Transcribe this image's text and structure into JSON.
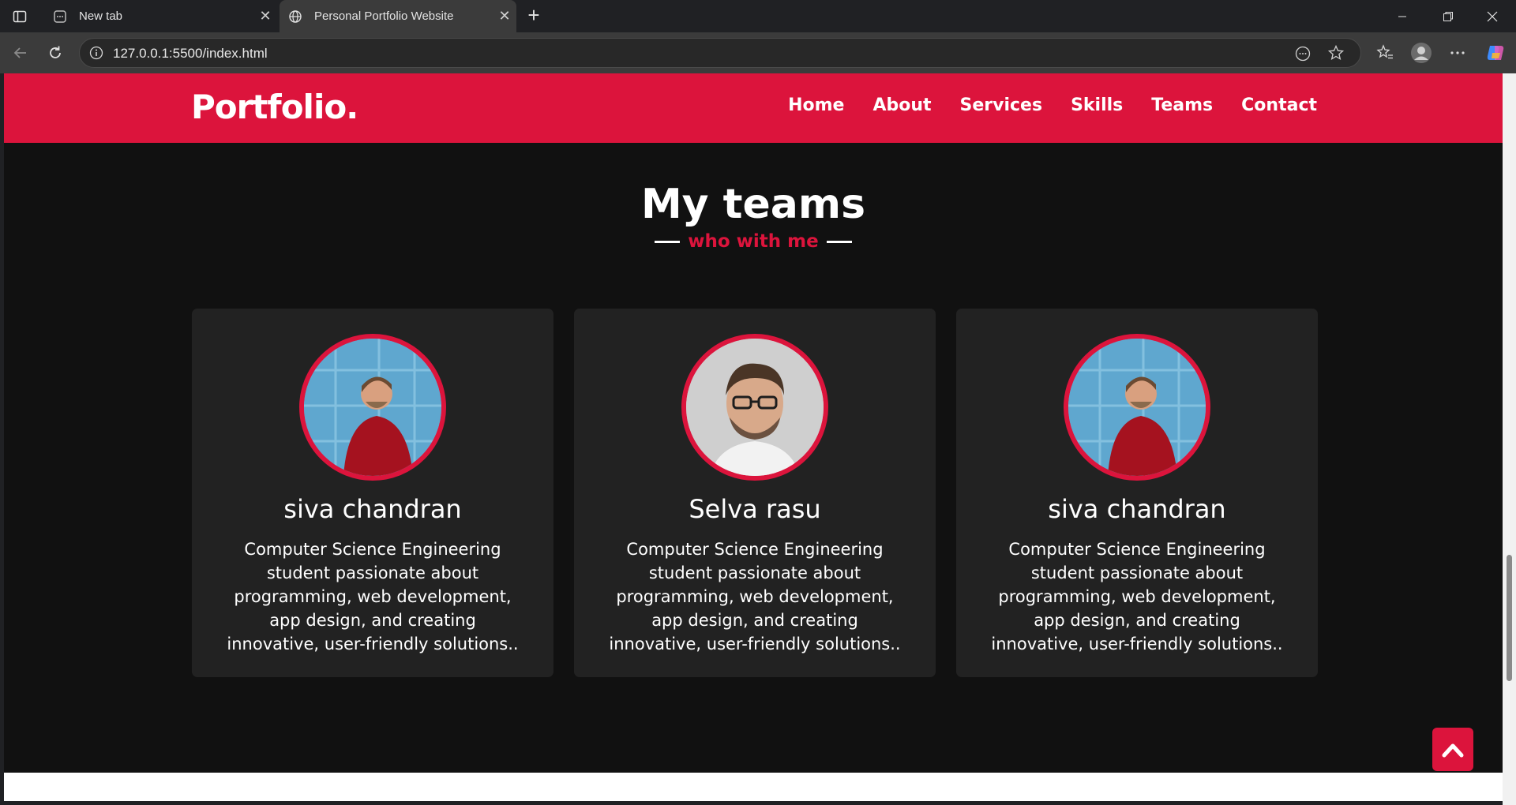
{
  "browser": {
    "tabs": [
      {
        "label": "New tab",
        "active": false
      },
      {
        "label": "Personal Portfolio Website",
        "active": true
      }
    ],
    "url": "127.0.0.1:5500/index.html"
  },
  "site": {
    "logo": "Portfolio.",
    "nav": [
      "Home",
      "About",
      "Services",
      "Skills",
      "Teams",
      "Contact"
    ],
    "accent_color": "#dc143c"
  },
  "teams": {
    "title": "My teams",
    "subtitle": "who with me",
    "members": [
      {
        "name": "siva chandran",
        "description": "Computer Science Engineering student passionate about programming, web development, app design, and creating innovative, user-friendly solutions.."
      },
      {
        "name": "Selva rasu",
        "description": "Computer Science Engineering student passionate about programming, web development, app design, and creating innovative, user-friendly solutions.."
      },
      {
        "name": "siva chandran",
        "description": "Computer Science Engineering student passionate about programming, web development, app design, and creating innovative, user-friendly solutions.."
      }
    ]
  }
}
